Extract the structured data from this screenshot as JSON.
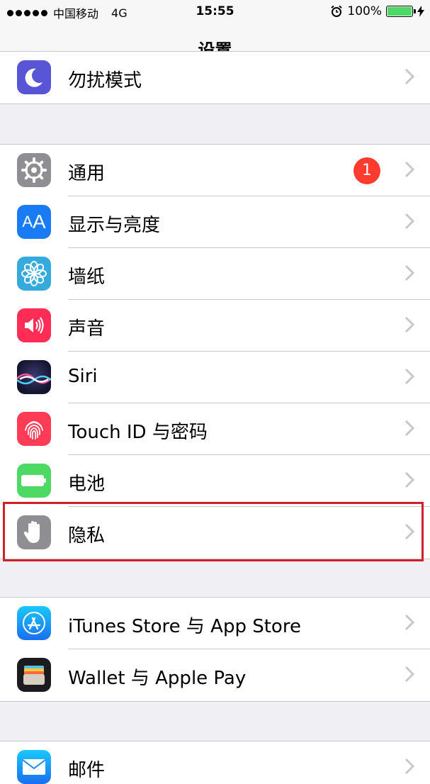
{
  "status_bar": {
    "carrier": "中国移动",
    "network": "4G",
    "time": "15:55",
    "battery": "100%"
  },
  "nav": {
    "title": "设置"
  },
  "groups": [
    {
      "items": [
        {
          "label": "勿扰模式",
          "icon": "moon-icon",
          "color": "#5856d6"
        }
      ]
    },
    {
      "items": [
        {
          "label": "通用",
          "icon": "gear-icon",
          "color": "#8e8e93",
          "badge": "1"
        },
        {
          "label": "显示与亮度",
          "icon": "text-size-icon",
          "color": "#1a7cf5"
        },
        {
          "label": "墙纸",
          "icon": "flower-icon",
          "color": "#36aadc"
        },
        {
          "label": "声音",
          "icon": "speaker-icon",
          "color": "#ff2d55"
        },
        {
          "label": "Siri",
          "icon": "siri-icon",
          "color": "#1c1c3a"
        },
        {
          "label": "Touch ID 与密码",
          "icon": "fingerprint-icon",
          "color": "#ff3b56"
        },
        {
          "label": "电池",
          "icon": "battery-icon",
          "color": "#4cd964"
        },
        {
          "label": "隐私",
          "icon": "hand-icon",
          "color": "#8e8e93"
        }
      ]
    },
    {
      "items": [
        {
          "label": "iTunes Store 与 App Store",
          "icon": "app-store-icon",
          "color": "#1a8cf7"
        },
        {
          "label": "Wallet 与 Apple Pay",
          "icon": "wallet-icon",
          "color": "#1c1c1e"
        }
      ]
    },
    {
      "items": [
        {
          "label": "邮件",
          "icon": "mail-icon",
          "color": "#1a8cf7"
        }
      ]
    }
  ]
}
